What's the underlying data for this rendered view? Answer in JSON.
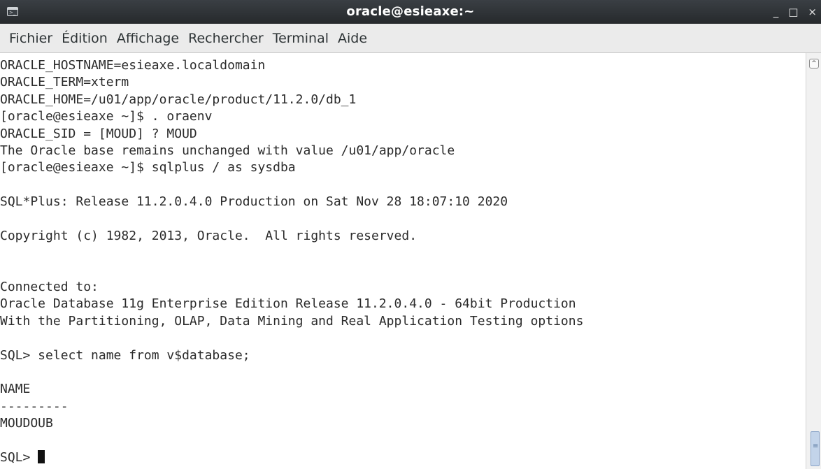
{
  "window": {
    "title": "oracle@esieaxe:~",
    "minimize_glyph": "_",
    "maximize_glyph": "□",
    "close_glyph": "×"
  },
  "menu": [
    {
      "label": "Fichier"
    },
    {
      "label": "Édition"
    },
    {
      "label": "Affichage"
    },
    {
      "label": "Rechercher"
    },
    {
      "label": "Terminal"
    },
    {
      "label": "Aide"
    }
  ],
  "terminal": {
    "lines": [
      "ORACLE_HOSTNAME=esieaxe.localdomain",
      "ORACLE_TERM=xterm",
      "ORACLE_HOME=/u01/app/oracle/product/11.2.0/db_1",
      "[oracle@esieaxe ~]$ . oraenv",
      "ORACLE_SID = [MOUD] ? MOUD",
      "The Oracle base remains unchanged with value /u01/app/oracle",
      "[oracle@esieaxe ~]$ sqlplus / as sysdba",
      "",
      "SQL*Plus: Release 11.2.0.4.0 Production on Sat Nov 28 18:07:10 2020",
      "",
      "Copyright (c) 1982, 2013, Oracle.  All rights reserved.",
      "",
      "",
      "Connected to:",
      "Oracle Database 11g Enterprise Edition Release 11.2.0.4.0 - 64bit Production",
      "With the Partitioning, OLAP, Data Mining and Real Application Testing options",
      "",
      "SQL> select name from v$database;",
      "",
      "NAME",
      "---------",
      "MOUDOUB",
      ""
    ],
    "prompt": "SQL> "
  },
  "colors": {
    "titlebar": "#2e3236",
    "menubar": "#ebebeb",
    "background": "#ffffff",
    "text": "#2b2b2b",
    "scroll_thumb": "#c3d4ea"
  },
  "icons": {
    "window_icon": "terminal-icon",
    "scroll_up": "chevron-up-icon"
  }
}
